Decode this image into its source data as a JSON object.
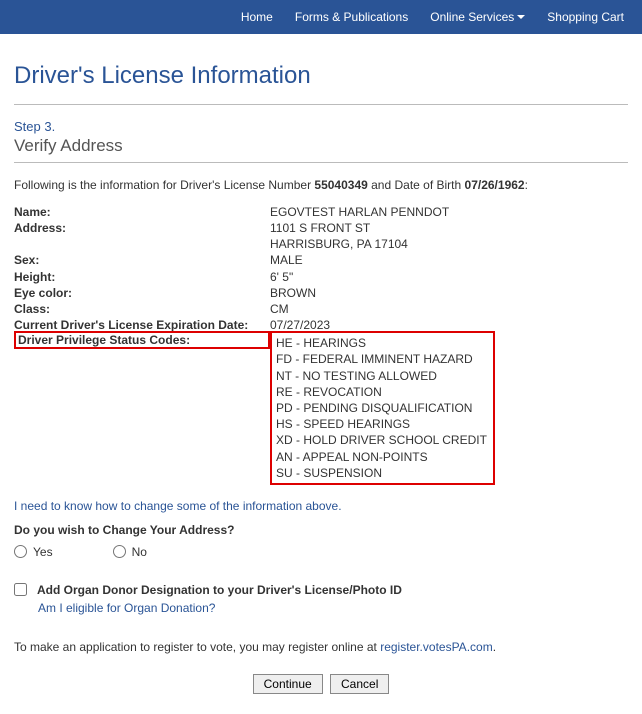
{
  "nav": {
    "home": "Home",
    "forms": "Forms & Publications",
    "online": "Online Services",
    "cart": "Shopping Cart"
  },
  "page_title": "Driver's License Information",
  "step_label": "Step 3.",
  "subtitle": "Verify Address",
  "intro": {
    "prefix": "Following is the information for Driver's License Number ",
    "dln": "55040349",
    "mid": " and Date of Birth ",
    "dob": "07/26/1962",
    "suffix": ":"
  },
  "info": {
    "name_label": "Name:",
    "name_value": "EGOVTEST HARLAN PENNDOT",
    "address_label": "Address:",
    "address_line1": "1101 S FRONT ST",
    "address_line2": "HARRISBURG, PA 17104",
    "sex_label": "Sex:",
    "sex_value": "MALE",
    "height_label": "Height:",
    "height_value": "6' 5\"",
    "eye_label": "Eye color:",
    "eye_value": "BROWN",
    "class_label": "Class:",
    "class_value": "CM",
    "exp_label": "Current Driver's License Expiration Date:",
    "exp_value": "07/27/2023",
    "priv_label": "Driver Privilege Status Codes:"
  },
  "status_codes": [
    "HE - HEARINGS",
    "FD - FEDERAL IMMINENT HAZARD",
    "NT - NO TESTING ALLOWED",
    "RE - REVOCATION",
    "PD - PENDING DISQUALIFICATION",
    "HS - SPEED HEARINGS",
    "XD - HOLD DRIVER SCHOOL CREDIT",
    "AN - APPEAL NON-POINTS",
    "SU - SUSPENSION"
  ],
  "change_info_link": "I need to know how to change some of the information above.",
  "change_address_q": "Do you wish to Change Your Address?",
  "yes": "Yes",
  "no": "No",
  "donor_checkbox": "Add Organ Donor Designation to your Driver's License/Photo ID",
  "donor_link": "Am I eligible for Organ Donation?",
  "vote": {
    "prefix": "To make an application to register to vote, you may register online at ",
    "link": "register.votesPA.com",
    "suffix": "."
  },
  "buttons": {
    "continue": "Continue",
    "cancel": "Cancel"
  }
}
